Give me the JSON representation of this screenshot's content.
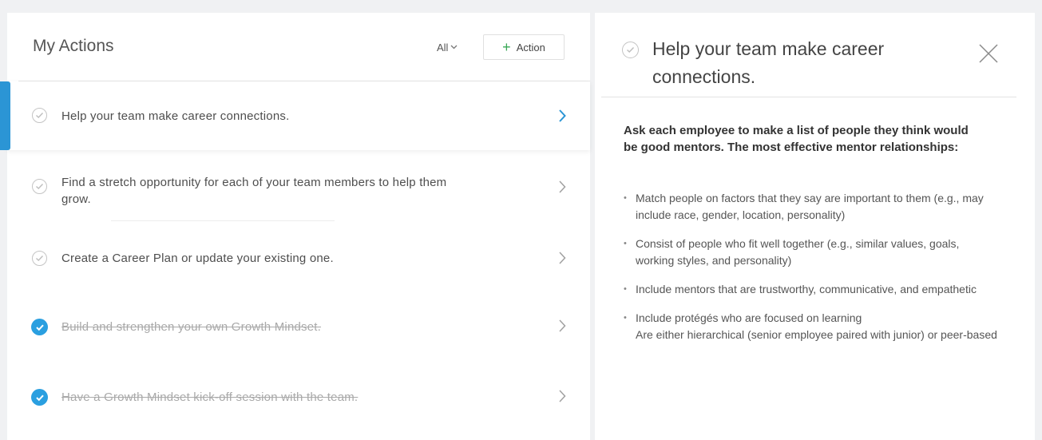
{
  "actions_panel": {
    "title": "My Actions",
    "filter_label": "All",
    "add_button_label": "Action",
    "items": [
      {
        "label": "Help your team make career connections.",
        "completed": false,
        "selected": true
      },
      {
        "label": "Find a stretch opportunity for each of your team members to help them grow.",
        "completed": false,
        "selected": false
      },
      {
        "label": "Create a Career Plan or update your existing one.",
        "completed": false,
        "selected": false
      },
      {
        "label": "Build and strengthen your own Growth Mindset.",
        "completed": true,
        "selected": false
      },
      {
        "label": "Have a Growth Mindset kick-off session with the team.",
        "completed": true,
        "selected": false
      }
    ]
  },
  "detail_panel": {
    "title": "Help your team make career connections.",
    "intro": "Ask each employee to make a list of people they think would be good mentors. The most effective mentor relationships:",
    "bullets": [
      "Match people on factors that they say are important to them (e.g., may include race, gender, location, personality)",
      "Consist of people who fit well together (e.g., similar values, goals, working styles, and personality)",
      "Include mentors that are trustworthy, communicative, and empathetic",
      "Include protégés who are focused on learning",
      "Are either hierarchical (senior employee paired with junior) or peer-based"
    ]
  },
  "colors": {
    "accent_blue": "#2b95d5",
    "check_done": "#2a9fe0",
    "plus_green": "#3aa857",
    "page_bg": "#f0f1f3"
  },
  "icons": {
    "filter": "chevron-down-icon",
    "add": "plus-icon",
    "row_open": "check-circle-outline-icon",
    "row_done": "check-circle-filled-icon",
    "row_nav": "chevron-right-icon",
    "close": "close-icon"
  }
}
